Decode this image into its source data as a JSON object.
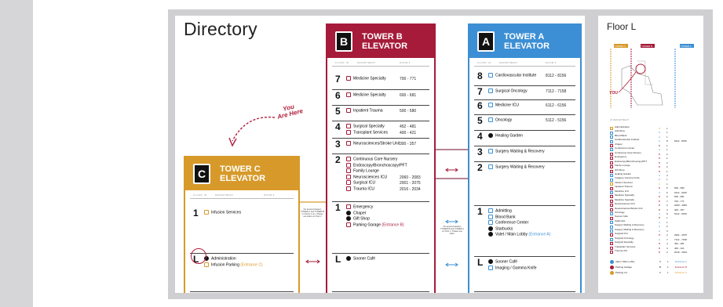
{
  "directory_title": "Directory",
  "you_are_here": "You\nAre Here",
  "floor_title": "Floor L",
  "col_headers": {
    "floor": "FLOOR",
    "id": "ID",
    "department": "DEPARTMENT",
    "rooms": "ROOM #"
  },
  "colors": {
    "tower_a": "#3c8fd4",
    "tower_b": "#a61b3a",
    "tower_c": "#d79a2a",
    "entrance": "#d79a2a",
    "entrance_a": "#3c8fd4",
    "entrance_b": "#a61b3a"
  },
  "tower_b": {
    "icon": "B",
    "name": "TOWER B",
    "sub": "ELEVATOR",
    "floors": [
      {
        "floor": "7",
        "items": [
          {
            "name": "Medicine Specialty",
            "rooms": "700 - 771"
          }
        ]
      },
      {
        "floor": "6",
        "items": [
          {
            "name": "Medicine Specialty",
            "rooms": "600 - 681"
          }
        ]
      },
      {
        "floor": "5",
        "items": [
          {
            "name": "Inpatient Trauma",
            "rooms": "500 - 580"
          }
        ]
      },
      {
        "floor": "4",
        "items": [
          {
            "name": "Surgical Specialty",
            "rooms": "452 - 481"
          },
          {
            "name": "Transplant Services",
            "rooms": "400 - 421"
          }
        ]
      },
      {
        "floor": "3",
        "items": [
          {
            "name": "Neurosciences/Stroke Unit",
            "rooms": "300 - 357"
          }
        ]
      },
      {
        "floor": "2",
        "items": [
          {
            "name": "Continuous Care Nursery",
            "rooms": ""
          },
          {
            "name": "Endoscopy/Bronchoscopy/PFT",
            "rooms": ""
          },
          {
            "name": "Family Lounge",
            "rooms": ""
          },
          {
            "name": "Neurosciences ICU",
            "rooms": "2060 - 2083"
          },
          {
            "name": "Surgical ICU",
            "rooms": "2001 - 2075"
          },
          {
            "name": "Trauma ICU",
            "rooms": "2016 - 2034"
          }
        ]
      },
      {
        "floor": "1",
        "items": [
          {
            "name": "Emergency",
            "rooms": ""
          },
          {
            "name": "Chapel",
            "rooms": ""
          },
          {
            "name": "Gift Shop",
            "rooms": ""
          },
          {
            "name": "Parking Garage",
            "rooms": "",
            "note": "(Entrance B)"
          }
        ]
      },
      {
        "floor": "L",
        "items": [
          {
            "name": "Sooner Café",
            "rooms": ""
          }
        ]
      }
    ]
  },
  "tower_a": {
    "icon": "A",
    "name": "TOWER A",
    "sub": "ELEVATOR",
    "floors": [
      {
        "floor": "8",
        "items": [
          {
            "name": "Cardiovascular Institute",
            "rooms": "8112 - 8156"
          }
        ]
      },
      {
        "floor": "7",
        "items": [
          {
            "name": "Surgical Oncology",
            "rooms": "7112 - 7158"
          }
        ]
      },
      {
        "floor": "6",
        "items": [
          {
            "name": "Medicine ICU",
            "rooms": "6112 - 6156"
          }
        ]
      },
      {
        "floor": "5",
        "items": [
          {
            "name": "Oncology",
            "rooms": "5112 - 5156"
          }
        ]
      },
      {
        "floor": "4",
        "items": [
          {
            "name": "Healing Garden",
            "rooms": ""
          }
        ]
      },
      {
        "floor": "3",
        "items": [
          {
            "name": "Surgery Waiting & Recovery",
            "rooms": ""
          }
        ]
      },
      {
        "floor": "2",
        "items": [
          {
            "name": "Surgery Waiting & Recovery",
            "rooms": ""
          }
        ]
      },
      {
        "floor": "1",
        "items": [
          {
            "name": "Admitting",
            "rooms": ""
          },
          {
            "name": "Blood Bank",
            "rooms": ""
          },
          {
            "name": "Conference Center",
            "rooms": ""
          },
          {
            "name": "Starbucks",
            "rooms": ""
          },
          {
            "name": "Valet / Main Lobby",
            "rooms": "",
            "note": "(Entrance A)"
          }
        ]
      },
      {
        "floor": "L",
        "items": [
          {
            "name": "Sooner Café",
            "rooms": ""
          },
          {
            "name": "Imaging / Gamma Knife",
            "rooms": ""
          }
        ]
      }
    ]
  },
  "tower_c": {
    "icon": "C",
    "name": "TOWER C",
    "sub": "ELEVATOR",
    "floors": [
      {
        "floor": "1",
        "items": [
          {
            "name": "Infusion Services",
            "rooms": ""
          }
        ]
      },
      {
        "floor": "L",
        "items": [
          {
            "name": "Administration",
            "rooms": ""
          },
          {
            "name": "Infusion Parking",
            "rooms": "",
            "note": "(Entrance C)"
          }
        ]
      }
    ]
  },
  "connector_notes": {
    "c_to_b": "No access between TOWER C and TOWER B on Floors 1 & L. Please use stairs on Floor 1",
    "b_to_a": "No access between TOWER B and TOWER A on Floor 1. Please use stairs."
  },
  "map_labels": {
    "tower_c": "TOWER C",
    "tower_b": "TOWER B",
    "tower_a": "TOWER A",
    "you": "YOU"
  },
  "map_legend": {
    "header": "ID  DEPARTMENT",
    "rows": [
      [
        "Administration",
        "C",
        "L",
        ""
      ],
      [
        "Admitting",
        "A",
        "1",
        ""
      ],
      [
        "Blood Bank",
        "A",
        "1",
        ""
      ],
      [
        "Cardiovascular Institute",
        "A",
        "8",
        "8112 - 8156"
      ],
      [
        "Chapel",
        "B",
        "1",
        ""
      ],
      [
        "Conference Center",
        "A",
        "1",
        ""
      ],
      [
        "Continuous Care Nursery",
        "B",
        "2",
        ""
      ],
      [
        "Emergency",
        "B",
        "1",
        ""
      ],
      [
        "Endoscopy/Bronchoscopy/PFT",
        "B",
        "2",
        ""
      ],
      [
        "Family Lounge",
        "B",
        "2",
        ""
      ],
      [
        "Gift Shop",
        "B",
        "1",
        ""
      ],
      [
        "Healing Garden",
        "A",
        "4",
        ""
      ],
      [
        "Imaging / Gamma Knife",
        "A",
        "L",
        ""
      ],
      [
        "Infusion Services",
        "C",
        "1",
        ""
      ],
      [
        "Inpatient Trauma",
        "B",
        "5",
        "500 - 580"
      ],
      [
        "Medicine ICU",
        "A",
        "6",
        "6112 - 6156"
      ],
      [
        "Medicine Specialty",
        "B",
        "6",
        "600 - 681"
      ],
      [
        "Medicine Specialty",
        "B",
        "7",
        "700 - 771"
      ],
      [
        "Neurosciences ICU",
        "B",
        "2",
        "2060 - 2083"
      ],
      [
        "Neurosciences/Stroke Unit",
        "B",
        "3",
        "300 - 357"
      ],
      [
        "Oncology",
        "A",
        "5",
        "5112 - 5156"
      ],
      [
        "Sooner Café",
        "B",
        "L",
        ""
      ],
      [
        "Starbucks",
        "A",
        "1",
        ""
      ],
      [
        "Surgery Waiting & Recovery",
        "A",
        "2",
        ""
      ],
      [
        "Surgery Waiting & Recovery",
        "A",
        "3",
        ""
      ],
      [
        "Surgical ICU",
        "B",
        "2",
        "2001 - 2075"
      ],
      [
        "Surgical Oncology",
        "A",
        "7",
        "7112 - 7158"
      ],
      [
        "Surgical Specialty",
        "B",
        "4",
        "452 - 481"
      ],
      [
        "Transplant Services",
        "B",
        "4",
        "400 - 421"
      ],
      [
        "Trauma ICU",
        "B",
        "2",
        "2016 - 2034"
      ]
    ],
    "footer": [
      [
        "Valet / Main Lobby",
        "A",
        "1",
        "Entrance A"
      ],
      [
        "Parking Garage",
        "B",
        "1",
        "Entrance B"
      ],
      [
        "Parking Lot",
        "C",
        "L",
        "Entrance C"
      ]
    ]
  }
}
